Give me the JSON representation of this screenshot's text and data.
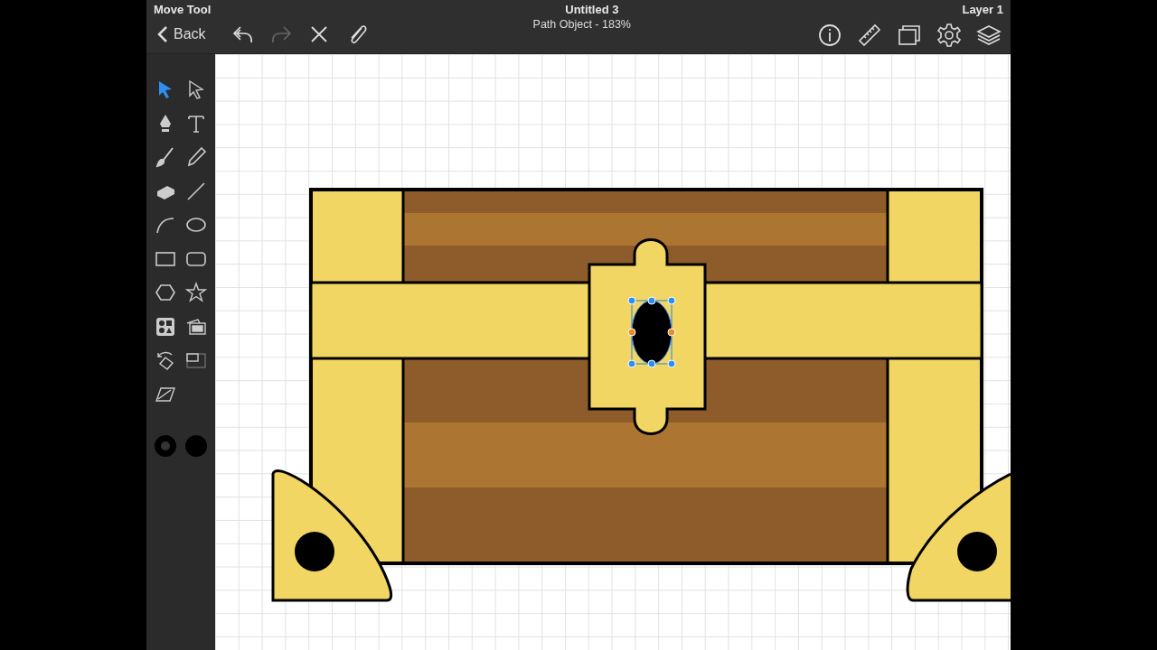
{
  "topbar": {
    "tool_name": "Move Tool",
    "title": "Untitled 3",
    "subtitle": "Path Object - 183%",
    "layer_name": "Layer 1",
    "back_label": "Back",
    "left_actions": [
      {
        "kind": "undo",
        "disabled": false
      },
      {
        "kind": "redo",
        "disabled": true
      },
      {
        "kind": "close",
        "disabled": false
      },
      {
        "kind": "attach",
        "disabled": false
      }
    ],
    "right_actions": [
      {
        "kind": "info"
      },
      {
        "kind": "ruler"
      },
      {
        "kind": "artboards"
      },
      {
        "kind": "settings"
      },
      {
        "kind": "layers"
      }
    ]
  },
  "tools": [
    {
      "kind": "select",
      "selected": true
    },
    {
      "kind": "direct-select",
      "selected": false
    },
    {
      "kind": "pen",
      "selected": false
    },
    {
      "kind": "text",
      "selected": false
    },
    {
      "kind": "brush",
      "selected": false
    },
    {
      "kind": "pencil",
      "selected": false
    },
    {
      "kind": "eraser",
      "selected": false
    },
    {
      "kind": "line",
      "selected": false
    },
    {
      "kind": "arc",
      "selected": false
    },
    {
      "kind": "ellipse",
      "selected": false
    },
    {
      "kind": "rectangle",
      "selected": false
    },
    {
      "kind": "rounded-rectangle",
      "selected": false
    },
    {
      "kind": "hexagon",
      "selected": false
    },
    {
      "kind": "star",
      "selected": false
    },
    {
      "kind": "shapes",
      "selected": false
    },
    {
      "kind": "images",
      "selected": false
    },
    {
      "kind": "rotate",
      "selected": false
    },
    {
      "kind": "resize",
      "selected": false
    },
    {
      "kind": "skew",
      "selected": false
    }
  ],
  "swatches": [
    {
      "kind": "stroke",
      "color": "#000000"
    },
    {
      "kind": "fill",
      "color": "#000000"
    }
  ]
}
